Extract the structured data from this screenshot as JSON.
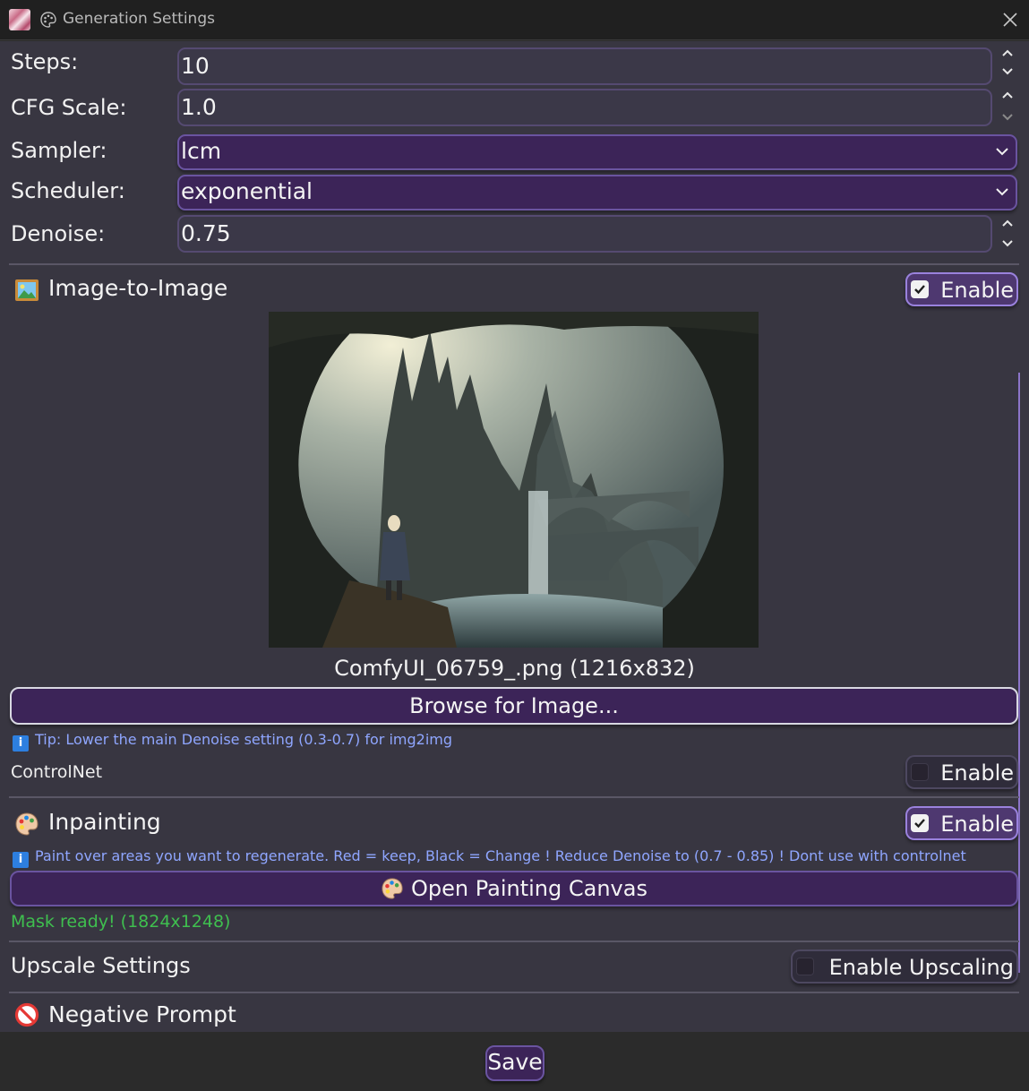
{
  "window": {
    "title": "Generation Settings"
  },
  "fields": {
    "steps": {
      "label": "Steps:",
      "value": "10"
    },
    "cfg": {
      "label": "CFG Scale:",
      "value": "1.0"
    },
    "sampler": {
      "label": "Sampler:",
      "value": "lcm"
    },
    "scheduler": {
      "label": "Scheduler:",
      "value": "exponential"
    },
    "denoise": {
      "label": "Denoise:",
      "value": "0.75"
    }
  },
  "img2img": {
    "title": "Image-to-Image",
    "enable_label": "Enable",
    "enabled": true,
    "image_caption": "ComfyUI_06759_.png (1216x832)",
    "browse_label": "Browse for Image...",
    "tip": "Tip: Lower the main Denoise setting (0.3-0.7) for img2img"
  },
  "controlnet": {
    "label": "ControlNet",
    "enable_label": "Enable",
    "enabled": false
  },
  "inpainting": {
    "title": "Inpainting",
    "enable_label": "Enable",
    "enabled": true,
    "info": "Paint over areas you want to regenerate. Red = keep, Black = Change ! Reduce Denoise to (0.7 - 0.85) ! Dont use with controlnet",
    "open_canvas_label": "Open Painting Canvas",
    "mask_status": "Mask ready! (1824x1248)"
  },
  "upscale": {
    "title": "Upscale Settings",
    "enable_label": "Enable Upscaling",
    "enabled": false
  },
  "negative": {
    "title": "Negative Prompt"
  },
  "footer": {
    "save_label": "Save"
  },
  "icons": {
    "palette": "palette-icon",
    "picture": "framed-picture-icon",
    "no_entry": "no-entry-icon",
    "info": "info-icon",
    "close": "close-icon",
    "spinner": "spin-up-down-icon",
    "dropdown": "chevron-down-icon"
  },
  "colors": {
    "accent": "#6a54a0",
    "button_bg": "#3c2458",
    "panel_bg": "#383641",
    "info_text": "#8fa6ff",
    "success_text": "#3fbf4f"
  }
}
